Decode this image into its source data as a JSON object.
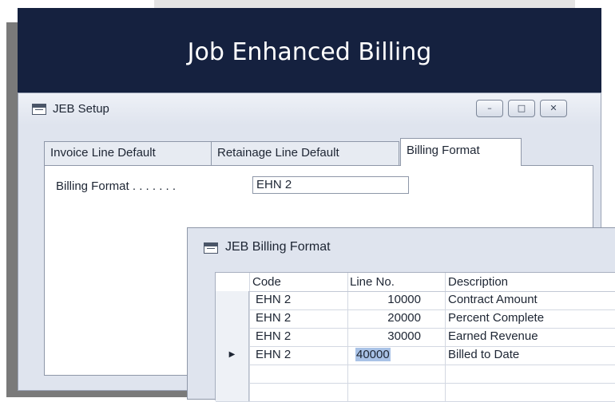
{
  "banner": {
    "title": "Job Enhanced Billing"
  },
  "setup_window": {
    "title": "JEB Setup",
    "controls": {
      "minimize": "–",
      "maximize": "□",
      "close": "✕"
    },
    "tabs": [
      {
        "label": "Invoice Line Default",
        "active": false
      },
      {
        "label": "Retainage Line Default",
        "active": false
      },
      {
        "label": "Billing Format",
        "active": true
      }
    ],
    "field": {
      "label": "Billing Format . . . . . . .",
      "value": "EHN 2"
    }
  },
  "billing_format_window": {
    "title": "JEB Billing Format",
    "columns": {
      "code": "Code",
      "line_no": "Line No.",
      "description": "Description"
    },
    "current_row_marker": "▶",
    "rows": [
      {
        "code": "EHN 2",
        "line_no": "10000",
        "description": "Contract Amount"
      },
      {
        "code": "EHN 2",
        "line_no": "20000",
        "description": "Percent Complete"
      },
      {
        "code": "EHN 2",
        "line_no": "30000",
        "description": "Earned Revenue"
      },
      {
        "code": "EHN 2",
        "line_no": "40000",
        "description": "Billed to Date"
      }
    ]
  },
  "colors": {
    "banner_bg": "#15213f",
    "selection": "#a9c2e6",
    "window_bg": "#dfe4ee"
  },
  "icons": [
    "window-icon",
    "minimize-icon",
    "maximize-icon",
    "close-icon",
    "current-row-arrow-icon"
  ]
}
